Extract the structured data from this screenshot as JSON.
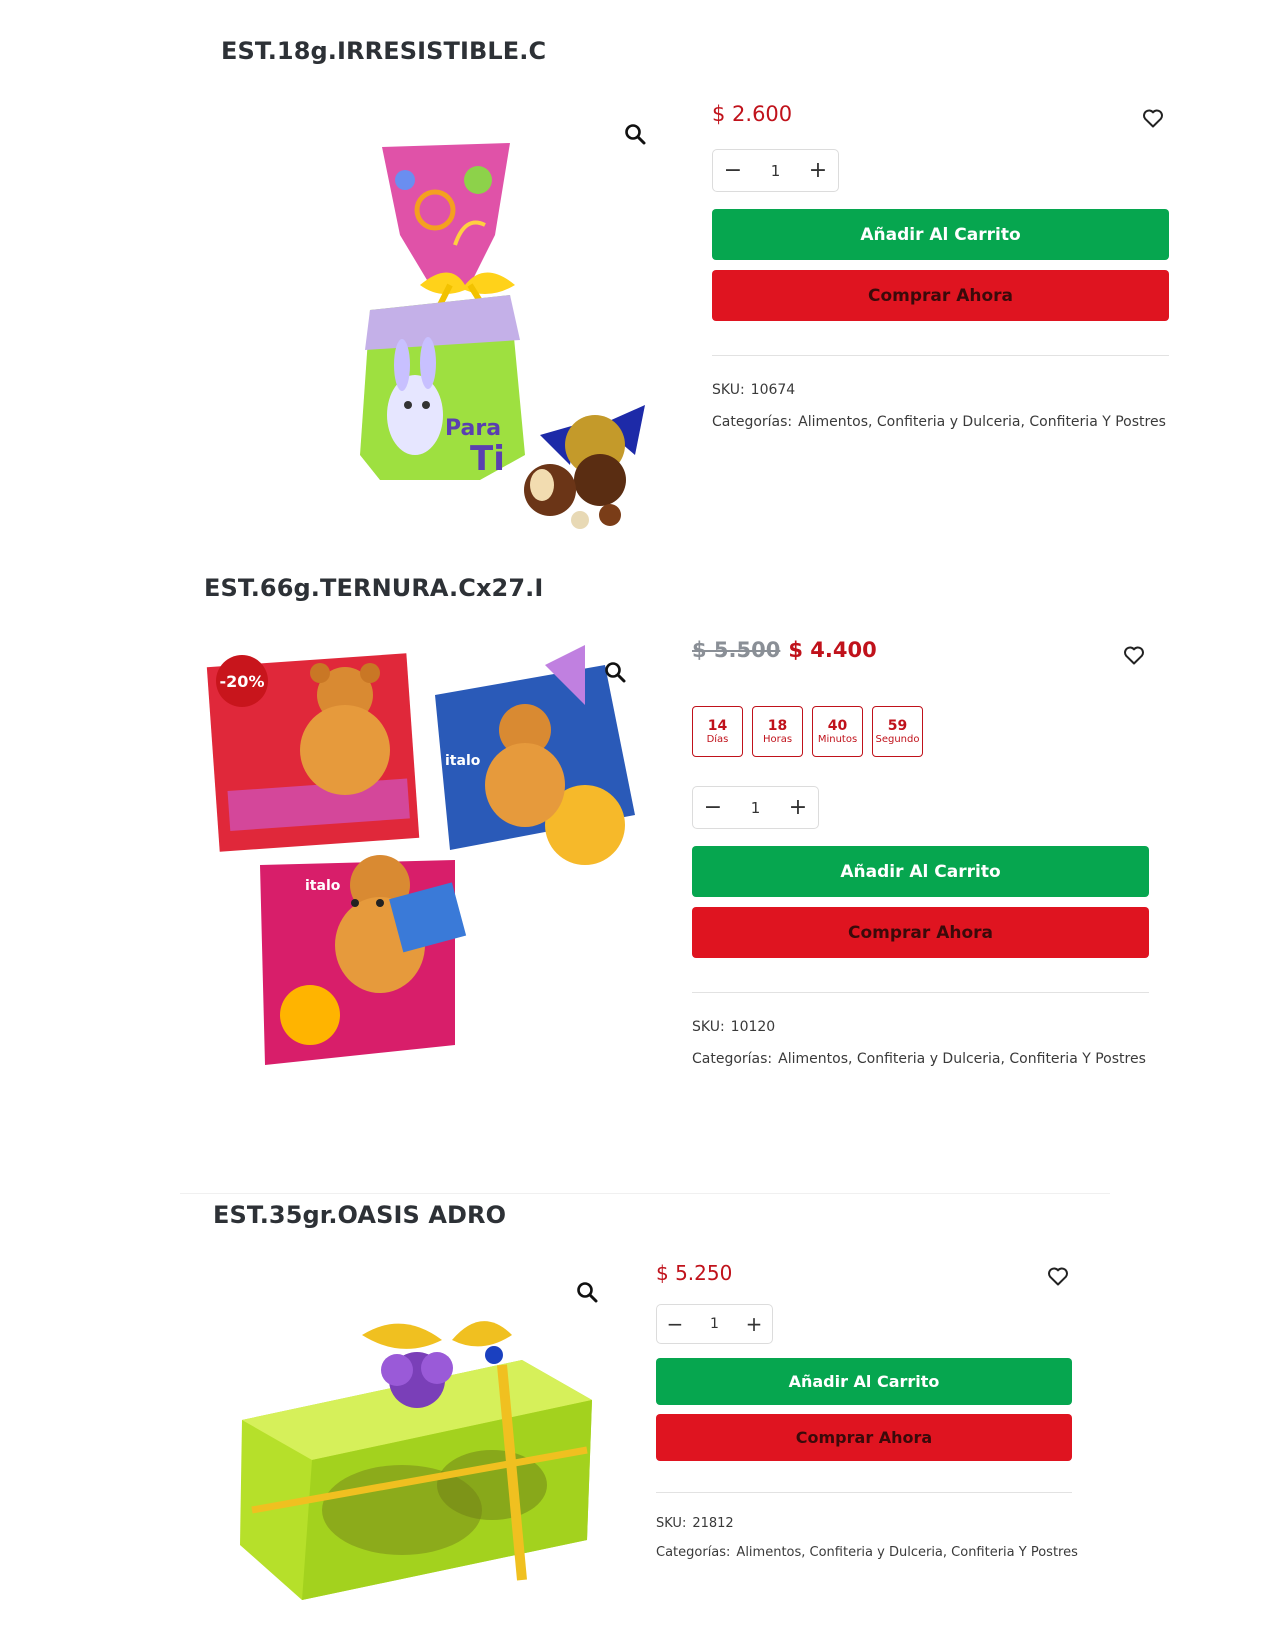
{
  "colors": {
    "price": "#c0121b",
    "cart_button": "#06a64f",
    "buy_button": "#df1420",
    "sale_badge": "#c8151c"
  },
  "icons": {
    "zoom": "magnifier-icon",
    "wishlist": "heart-outline-icon",
    "minus": "minus-icon",
    "plus": "plus-icon"
  },
  "products": [
    {
      "title": "EST.18g.IRRESISTIBLE.C",
      "price": "$ 2.600",
      "quantity": "1",
      "qty_minus": "−",
      "qty_plus": "+",
      "add_to_cart": "Añadir Al Carrito",
      "buy_now": "Comprar Ahora",
      "sku_label": "SKU:",
      "sku": "10674",
      "categories_label": "Categorías:",
      "categories": "Alimentos, Confiteria y Dulceria, Confiteria Y Postres"
    },
    {
      "title": "EST.66g.TERNURA.Cx27.I",
      "sale_badge": "-20%",
      "price_old": "$ 5.500",
      "price": "$ 4.400",
      "countdown": [
        {
          "value": "14",
          "unit": "Días"
        },
        {
          "value": "18",
          "unit": "Horas"
        },
        {
          "value": "40",
          "unit": "Minutos"
        },
        {
          "value": "59",
          "unit": "Segundo"
        }
      ],
      "quantity": "1",
      "qty_minus": "−",
      "qty_plus": "+",
      "add_to_cart": "Añadir Al Carrito",
      "buy_now": "Comprar Ahora",
      "sku_label": "SKU:",
      "sku": "10120",
      "categories_label": "Categorías:",
      "categories": "Alimentos, Confiteria y Dulceria, Confiteria Y Postres"
    },
    {
      "title": "EST.35gr.OASIS ADRO",
      "price": "$ 5.250",
      "quantity": "1",
      "qty_minus": "−",
      "qty_plus": "+",
      "add_to_cart": "Añadir Al Carrito",
      "buy_now": "Comprar Ahora",
      "sku_label": "SKU:",
      "sku": "21812",
      "categories_label": "Categorías:",
      "categories": "Alimentos, Confiteria y Dulceria, Confiteria Y Postres"
    }
  ]
}
